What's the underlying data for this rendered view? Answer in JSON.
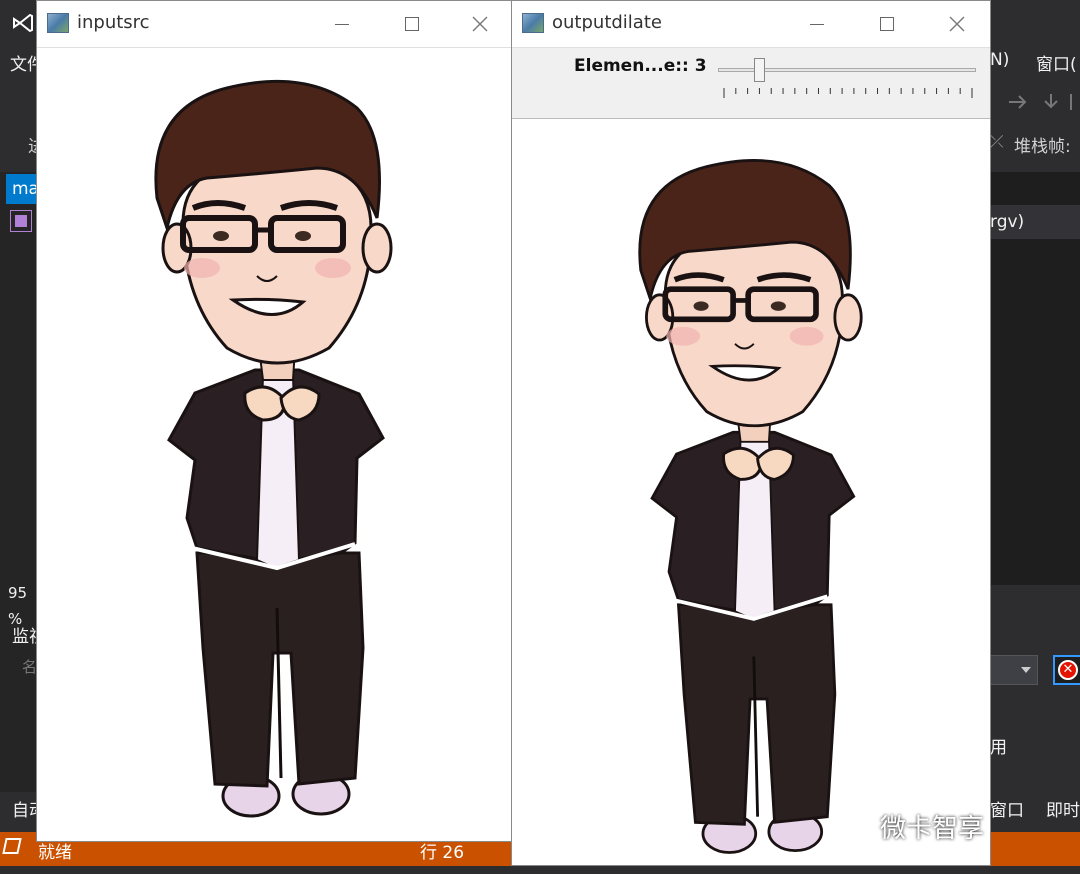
{
  "background_app": {
    "menu": {
      "file": "文件(",
      "window": "窗口(",
      "help_fragment": "N)"
    },
    "debug_toolbar": {
      "stack_frame": "堆栈帧:",
      "first_char": "进"
    },
    "doc_tab": "ma",
    "right_header": "rgv)",
    "zoom": "95 %",
    "watch_label": "监视",
    "name_col": "名",
    "auto_label": "自动",
    "right_labels": {
      "item": "用",
      "window": "窗口",
      "immediate": "即时"
    },
    "status": {
      "ready": "就绪",
      "line": "行 26"
    },
    "watermark": "微卡智享"
  },
  "windows": {
    "input": {
      "title": "inputsrc"
    },
    "output": {
      "title": "outputdilate",
      "trackbar": {
        "label": "Elemen...e:: 3",
        "value": 3,
        "max": 21,
        "ticks": 22
      }
    }
  },
  "colors": {
    "vs_status_bar": "#ca5100",
    "vs_accent": "#007acc",
    "vs_background": "#2d2d30"
  }
}
